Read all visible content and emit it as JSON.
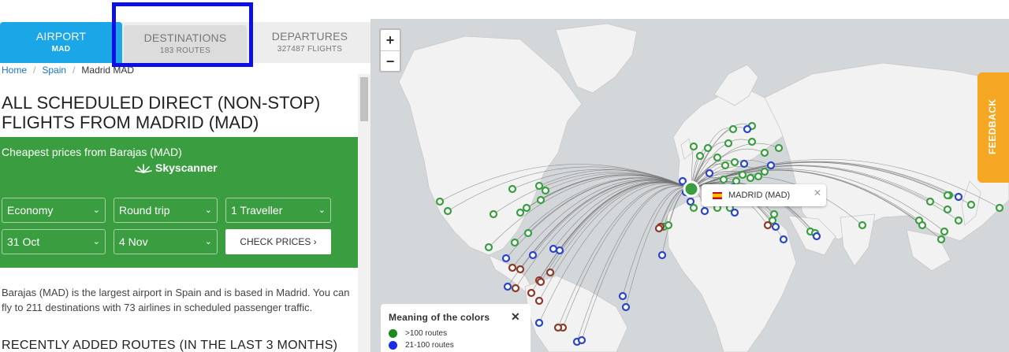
{
  "tabs": [
    {
      "label": "AIRPORT",
      "sub": "MAD"
    },
    {
      "label": "DESTINATIONS",
      "sub": "183 ROUTES"
    },
    {
      "label": "DEPARTURES",
      "sub": "327487 FLIGHTS"
    }
  ],
  "breadcrumb": {
    "home": "Home",
    "country": "Spain",
    "current": "Madrid MAD"
  },
  "page_title": "ALL SCHEDULED DIRECT (NON-STOP) FLIGHTS FROM MADRID (MAD)",
  "prices": {
    "heading": "Cheapest prices from Barajas (MAD)",
    "brand": "Skyscanner",
    "cabin": "Economy",
    "trip": "Round trip",
    "travellers": "1 Traveller",
    "depart": "31 Oct",
    "return": "4 Nov",
    "check": "CHECK PRICES ›"
  },
  "description": "Barajas (MAD) is the largest airport in Spain and is based in Madrid. You can fly to 211 destinations with 73 airlines in scheduled passenger traffic.",
  "recent_heading": "RECENTLY ADDED ROUTES (IN THE LAST 3 MONTHS)",
  "map": {
    "zoom_in": "+",
    "zoom_out": "−",
    "popup": "MADRID (MAD)",
    "popup_close": "✕",
    "feedback": "FEEDBACK",
    "legend": {
      "title": "Meaning of the colors",
      "close": "✕",
      "items": [
        {
          "label": ">100 routes",
          "color": "#1a8a1f"
        },
        {
          "label": "21-100 routes",
          "color": "#1a2ee6"
        }
      ]
    },
    "colors": {
      "green": "#3a9e40",
      "blue": "#2a46c8",
      "brown": "#8a3a2a",
      "line": "#707070"
    }
  },
  "icons": {
    "chevron": "chevron-down-icon",
    "skyscanner": "skyscanner-logo-icon",
    "flag": "spain-flag-icon",
    "close": "close-icon"
  }
}
